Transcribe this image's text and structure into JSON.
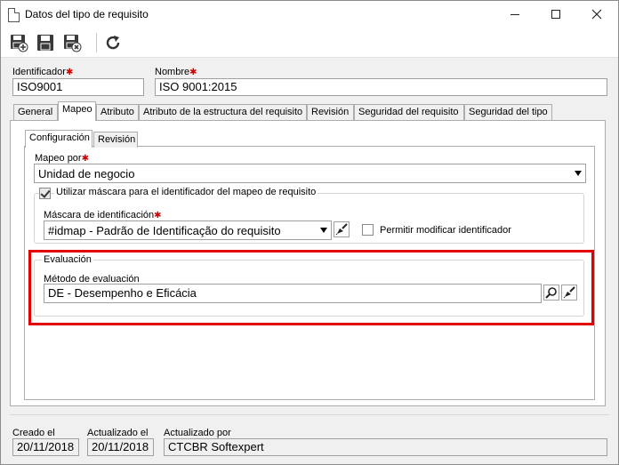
{
  "window": {
    "title": "Datos del tipo de requisito"
  },
  "toolbar": {
    "buttons": [
      {
        "name": "save-new",
        "icon": "save-plus-icon"
      },
      {
        "name": "save",
        "icon": "save-icon"
      },
      {
        "name": "save-close",
        "icon": "save-close-icon"
      },
      {
        "name": "refresh",
        "icon": "refresh-icon"
      }
    ]
  },
  "header": {
    "identificador_label": "Identificador",
    "identificador_value": "ISO9001",
    "nombre_label": "Nombre",
    "nombre_value": "ISO 9001:2015"
  },
  "tabs": [
    {
      "label": "General",
      "active": false
    },
    {
      "label": "Mapeo",
      "active": true
    },
    {
      "label": "Atributo",
      "active": false
    },
    {
      "label": "Atributo de la estructura del requisito",
      "active": false
    },
    {
      "label": "Revisión",
      "active": false
    },
    {
      "label": "Seguridad del requisito",
      "active": false
    },
    {
      "label": "Seguridad del tipo",
      "active": false
    }
  ],
  "subtabs": [
    {
      "label": "Configuración",
      "active": true
    },
    {
      "label": "Revisión",
      "active": false
    }
  ],
  "mapeo": {
    "mapeo_por_label": "Mapeo por",
    "mapeo_por_value": "Unidad de negocio",
    "mask_checkbox_label": "Utilizar máscara para el identificador del mapeo de requisito",
    "mask_checked": true,
    "mascara_label": "Máscara de identificación",
    "mascara_value": "#idmap - Padrão de Identificação do requisito",
    "permitir_label": "Permitir modificar identificador",
    "permitir_checked": false
  },
  "evaluacion": {
    "group_title": "Evaluación",
    "metodo_label": "Método de evaluación",
    "metodo_value": "DE - Desempenho e Eficácia"
  },
  "footer": {
    "creado_label": "Creado el",
    "creado_value": "20/11/2018",
    "actualizado_label": "Actualizado el",
    "actualizado_value": "20/11/2018",
    "actualizado_por_label": "Actualizado por",
    "actualizado_por_value": "CTCBR Softexpert"
  },
  "colors": {
    "required": "#d20000",
    "highlight": "#e20000"
  }
}
